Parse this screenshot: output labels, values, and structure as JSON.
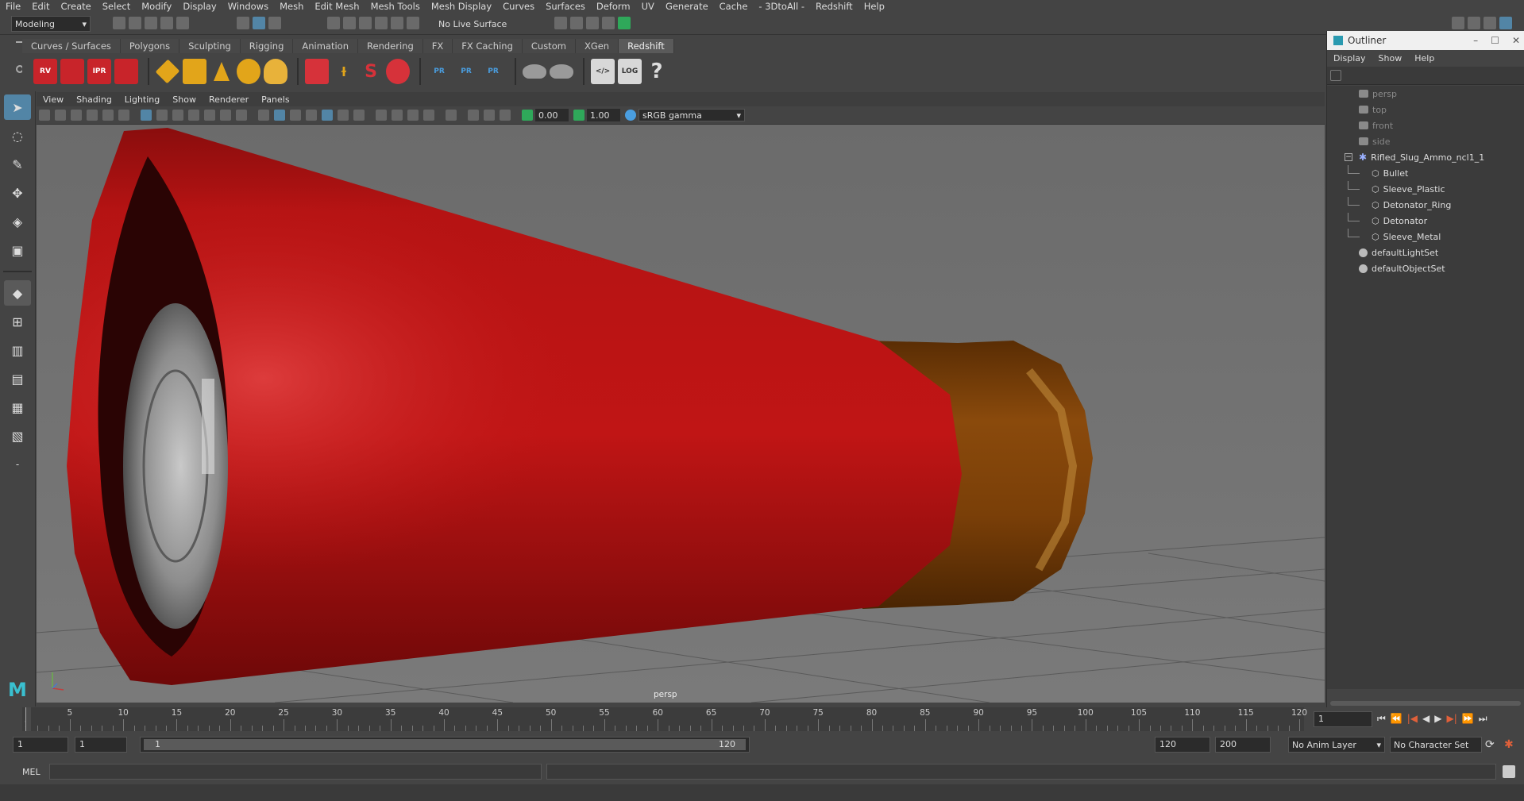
{
  "menus": [
    "File",
    "Edit",
    "Create",
    "Select",
    "Modify",
    "Display",
    "Windows",
    "Mesh",
    "Edit Mesh",
    "Mesh Tools",
    "Mesh Display",
    "Curves",
    "Surfaces",
    "Deform",
    "UV",
    "Generate",
    "Cache",
    "- 3DtoAll -",
    "Redshift",
    "Help"
  ],
  "status_line": {
    "mode": "Modeling",
    "live_surface": "No Live Surface"
  },
  "shelf_tabs": [
    "Curves / Surfaces",
    "Polygons",
    "Sculpting",
    "Rigging",
    "Animation",
    "Rendering",
    "FX",
    "FX Caching",
    "Custom",
    "XGen",
    "Redshift"
  ],
  "active_shelf_tab": "Redshift",
  "shelf_icons": {
    "rs_render_labels": [
      "RV",
      "",
      "IPR",
      ""
    ],
    "pr_labels": [
      "PR",
      "PR",
      "PR"
    ],
    "log_label": "LOG",
    "help_glyph": "?"
  },
  "viewport_menu": [
    "View",
    "Shading",
    "Lighting",
    "Show",
    "Renderer",
    "Panels"
  ],
  "viewport_toolbar": {
    "exposure": "0.00",
    "gamma": "1.00",
    "color_space": "sRGB gamma"
  },
  "viewport_label": "persp",
  "outliner": {
    "title": "Outliner",
    "menu": [
      "Display",
      "Show",
      "Help"
    ],
    "items": [
      {
        "name": "persp",
        "type": "camera",
        "dim": true,
        "indent": 0
      },
      {
        "name": "top",
        "type": "camera",
        "dim": true,
        "indent": 0
      },
      {
        "name": "front",
        "type": "camera",
        "dim": true,
        "indent": 0
      },
      {
        "name": "side",
        "type": "camera",
        "dim": true,
        "indent": 0
      },
      {
        "name": "Rifled_Slug_Ammo_ncl1_1",
        "type": "group",
        "dim": false,
        "indent": 0,
        "expanded": true
      },
      {
        "name": "Bullet",
        "type": "mesh",
        "dim": false,
        "indent": 1
      },
      {
        "name": "Sleeve_Plastic",
        "type": "mesh",
        "dim": false,
        "indent": 1
      },
      {
        "name": "Detonator_Ring",
        "type": "mesh",
        "dim": false,
        "indent": 1
      },
      {
        "name": "Detonator",
        "type": "mesh",
        "dim": false,
        "indent": 1
      },
      {
        "name": "Sleeve_Metal",
        "type": "mesh",
        "dim": false,
        "indent": 1
      },
      {
        "name": "defaultLightSet",
        "type": "set",
        "dim": false,
        "indent": 0
      },
      {
        "name": "defaultObjectSet",
        "type": "set",
        "dim": false,
        "indent": 0
      }
    ]
  },
  "timeline": {
    "tick_labels": [
      "1",
      "5",
      "10",
      "15",
      "20",
      "25",
      "30",
      "35",
      "40",
      "45",
      "50",
      "55",
      "60",
      "65",
      "70",
      "75",
      "80",
      "85",
      "90",
      "95",
      "100",
      "105",
      "110",
      "115",
      "120"
    ],
    "tick_values": [
      1,
      5,
      10,
      15,
      20,
      25,
      30,
      35,
      40,
      45,
      50,
      55,
      60,
      65,
      70,
      75,
      80,
      85,
      90,
      95,
      100,
      105,
      110,
      115,
      120
    ],
    "current_frame": "1"
  },
  "range": {
    "start_field": "1",
    "inner_start_field": "1",
    "slider_start": "1",
    "slider_end": "120",
    "end_field": "120",
    "max_field": "200",
    "anim_layer": "No Anim Layer",
    "character_set": "No Character Set"
  },
  "command_line": {
    "label": "MEL"
  },
  "colors": {
    "shell_red": "#b01212",
    "metal_brass": "#7a4208",
    "slug_gray": "#8a8a8a",
    "ui_bg": "#444444",
    "accent_blue": "#5285a6"
  }
}
